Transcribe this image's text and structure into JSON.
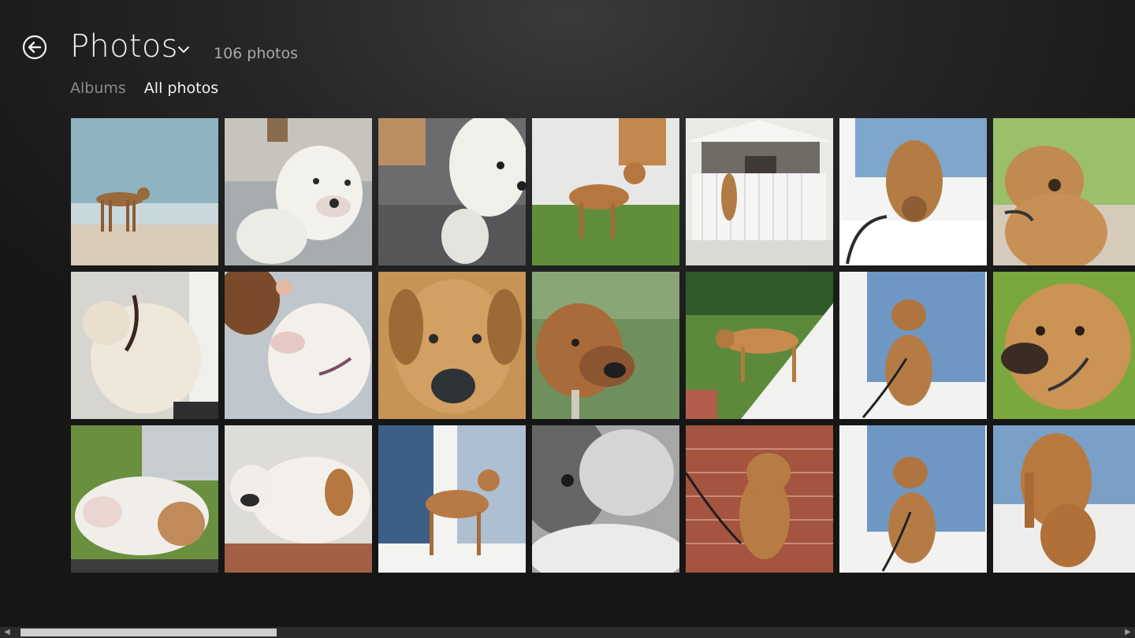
{
  "header": {
    "title": "Photos",
    "count": "106 photos"
  },
  "tabs": [
    {
      "label": "Albums",
      "active": false
    },
    {
      "label": "All photos",
      "active": true
    }
  ],
  "icons": {
    "back": "back-arrow-circle-icon",
    "dropdown": "chevron-down-icon",
    "scroll_left": "arrow-left-icon",
    "scroll_right": "arrow-right-icon"
  },
  "scroll": {
    "position": 0.0
  },
  "colors": {
    "background": "#1b1b1b",
    "text": "#f2f2f2",
    "muted": "#8a8a8a"
  }
}
